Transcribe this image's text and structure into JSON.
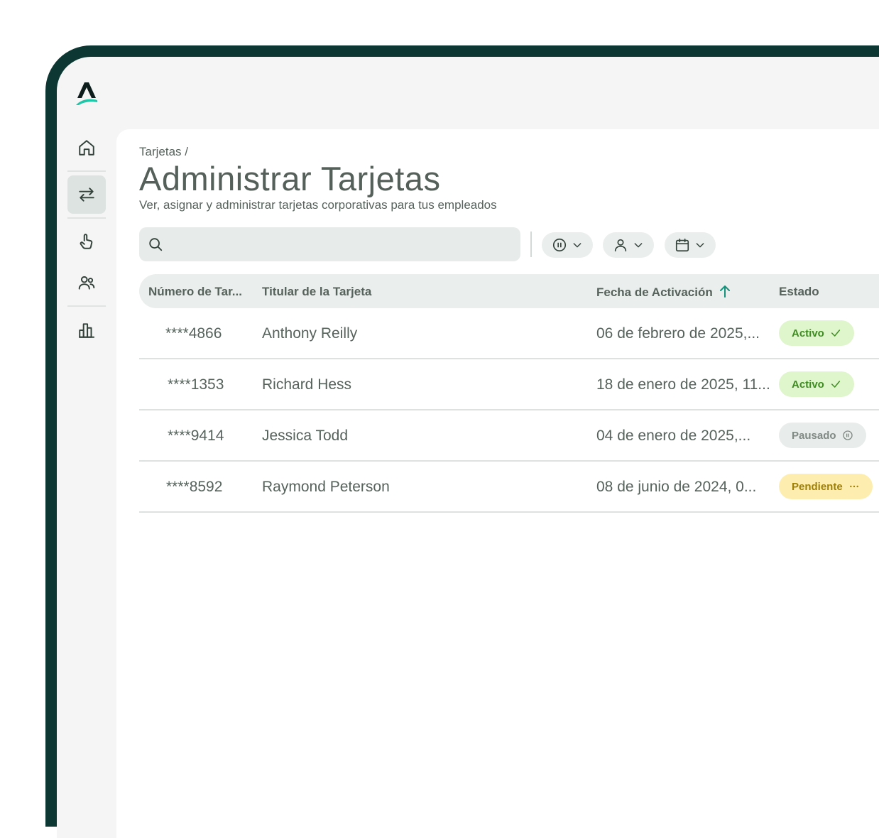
{
  "sidebar": {
    "logo": "A",
    "items": [
      {
        "icon": "home-icon"
      },
      {
        "icon": "transfer-icon",
        "active": true
      },
      {
        "icon": "tap-icon"
      },
      {
        "icon": "users-icon"
      },
      {
        "icon": "chart-icon"
      }
    ]
  },
  "header": {
    "breadcrumb": "Tarjetas /",
    "title": "Administrar Tarjetas",
    "subtitle": "Ver, asignar y administrar tarjetas corporativas para tus empleados"
  },
  "search": {
    "placeholder": ""
  },
  "filters": [
    {
      "icon": "pause-circle-icon"
    },
    {
      "icon": "user-icon"
    },
    {
      "icon": "calendar-icon"
    }
  ],
  "table": {
    "columns": [
      "Número de Tar...",
      "Titular de la Tarjeta",
      "Fecha de Activación",
      "Estado"
    ],
    "rows": [
      {
        "card": "****4866",
        "holder": "Anthony Reilly",
        "date": "06 de febrero de 2025,...",
        "status": "Activo"
      },
      {
        "card": "****1353",
        "holder": "Richard Hess",
        "date": "18 de enero de 2025, 11...",
        "status": "Activo"
      },
      {
        "card": "****9414",
        "holder": "Jessica Todd",
        "date": "04 de enero de 2025,...",
        "status": "Pausado"
      },
      {
        "card": "****8592",
        "holder": "Raymond Peterson",
        "date": "08 de junio de 2024, 0...",
        "status": "Pendiente"
      }
    ]
  },
  "colors": {
    "frame": "#0c3733",
    "accent": "#1fc7a8",
    "activo": "#3f8c22",
    "pausado": "#808a85",
    "pendiente": "#a07f06"
  }
}
